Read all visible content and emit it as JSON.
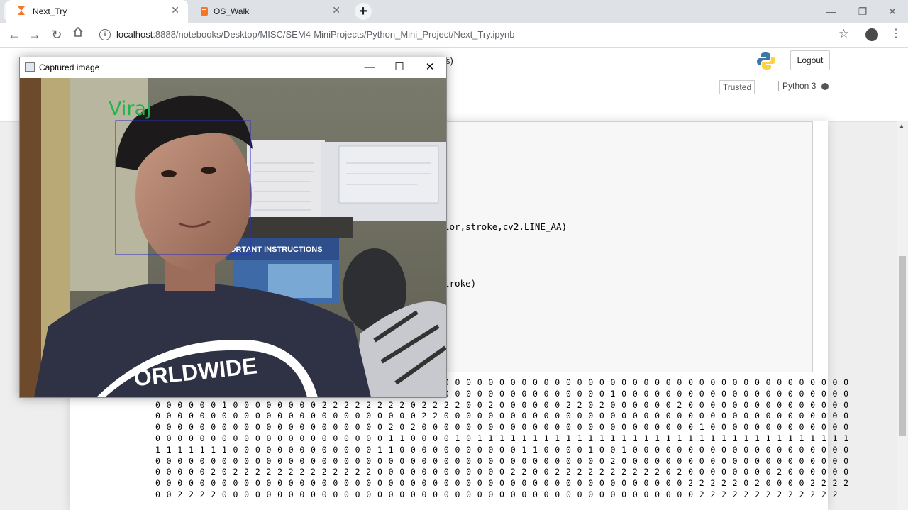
{
  "browser": {
    "tabs": [
      {
        "title": "Next_Try",
        "close": "✕"
      },
      {
        "title": "OS_Walk",
        "close": "✕"
      }
    ],
    "new_tab": "+",
    "window_controls": [
      "—",
      "❐",
      "✕"
    ],
    "url": {
      "host": "localhost",
      "path": ":8888/notebooks/Desktop/MISC/SEM4-MiniProjects/Python_Mini_Project/Next_Try.ipynb"
    }
  },
  "jupyter": {
    "title_fragment": "s)",
    "logout": "Logout",
    "trusted": "Trusted",
    "kernel": "Python 3",
    "code_fragments": [
      "lor,stroke,cv2.LINE_AA)",
      "troke)"
    ],
    "output_lines": [
      "0 0 0 0 0 0 0 0 0 0 0 0 0 0 0 0 0 0 0 0 0 0 0 0 0 0 0 0 0 0 0 0 0 0 0 0 0 0 0 0 0 0 0 0 0 0 0 0 0 0 0 0 0 0 0 0 0 0 0 0 0 0 0",
      "0 0 0 0 0 0 0 0 0 0 0 0 0 0 0 0 0 0 0 0 0 0 0 0 0 0 0 0 0 0 0 0 0 0 0 0 0 0 0 0 0 1 0 0 0 0 0 0 0 0 0 0 0 0 0 0 0 0 0 0 0 0 0",
      "0 0 0 0 0 0 1 0 0 0 0 0 0 0 0 2 2 2 2 2 2 2 2 0 2 2 2 2 0 0 2 0 0 0 0 0 0 2 2 0 2 0 0 0 0 0 0 2 0 0 0 0 0 0 0 0 0 0 0 0 0 0 0",
      "0 0 0 0 0 0 0 0 0 0 0 0 0 0 0 0 0 0 0 0 0 0 0 0 2 2 0 0 0 0 0 0 0 0 0 0 0 0 0 0 0 0 0 0 0 0 0 0 0 0 0 0 0 0 0 0 0 0 0 0 0 0 0",
      "0 0 0 0 0 0 0 0 0 0 0 0 0 0 0 0 0 0 0 0 0 2 0 2 0 0 0 0 0 0 0 0 0 0 0 0 0 0 0 0 0 0 0 0 0 0 0 0 0 1 0 0 0 0 0 0 0 0 0 0 0 0 0",
      "0 0 0 0 0 0 0 0 0 0 0 0 0 0 0 0 0 0 0 0 0 1 1 0 0 0 0 1 0 1 1 1 1 1 1 1 1 1 1 1 1 1 1 1 1 1 1 1 1 1 1 1 1 1 1 1 1 1 1 1 1 1 1",
      "1 1 1 1 1 1 1 0 0 0 0 0 0 0 0 0 0 0 0 0 1 1 0 0 0 0 0 0 0 0 0 0 0 1 1 0 0 0 0 1 0 0 1 0 0 0 0 0 0 0 0 0 0 0 0 0 0 0 0 0 0 0 0",
      "0 0 0 0 0 0 0 0 0 0 0 0 0 0 0 0 0 0 0 0 0 0 0 0 0 0 0 0 0 0 0 0 0 0 0 0 0 0 0 0 0 2 0 0 0 0 0 0 0 0 0 0 0 0 0 0 0 0 0 0 0 0 0",
      "0 0 0 0 0 2 0 2 2 2 2 2 2 2 2 2 2 2 2 2 0 0 0 0 0 0 0 0 0 0 0 0 2 2 0 0 2 2 2 2 2 2 2 2 2 2 0 2 0 0 0 0 0 0 0 0 2 0 0 0 0 0 0",
      "0 0 0 0 0 0 0 0 0 0 0 0 0 0 0 0 0 0 0 0 0 0 0 0 0 0 0 0 0 0 0 0 0 0 0 0 0 0 0 0 0 0 0 0 0 0 0 0 2 2 2 2 2 0 2 0 0 0 0 2 2 2 2",
      "0 0 2 2 2 2 0 0 0 0 0 0 0 0 0 0 0 0 0 0 0 0 0 0 0 0 0 0 0 0 0 0 0 0 0 0 0 0 0 0 0 0 0 0 0 0 0 0 0 2 2 2 2 2 2 2 2 2 2 2 2 2"
    ]
  },
  "capture_window": {
    "title": "Captured image",
    "controls": [
      "—",
      "☐",
      "✕"
    ],
    "label": "Viraj",
    "poster_text": "ORTANT  INSTRUCTIONS",
    "shirt_text": "ORLDWIDE",
    "colors": {
      "label_color": "#22b34a",
      "box_color": "#2a2fbf"
    }
  }
}
